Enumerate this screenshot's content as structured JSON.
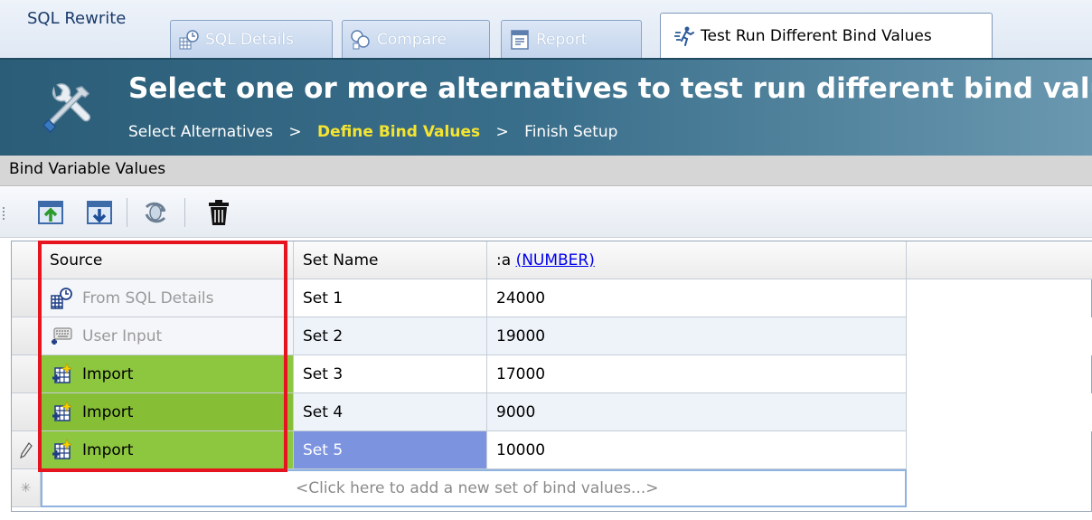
{
  "app": {
    "title": "SQL Rewrite"
  },
  "tabs": [
    {
      "label": "SQL Details",
      "icon": "sql-details-icon"
    },
    {
      "label": "Compare",
      "icon": "compare-icon"
    },
    {
      "label": "Report",
      "icon": "report-icon"
    },
    {
      "label": "Test Run Different Bind Values",
      "icon": "test-run-icon"
    }
  ],
  "banner": {
    "title": "Select one or more alternatives to test run different bind values",
    "breadcrumb": {
      "step1": "Select Alternatives",
      "separator": ">",
      "step2": "Define Bind Values",
      "step3": "Finish Setup"
    }
  },
  "section": {
    "title": "Bind Variable Values"
  },
  "toolbar": {
    "buttons": [
      "import-icon",
      "export-icon",
      "refresh-icon",
      "trash-icon"
    ]
  },
  "grid": {
    "columns": {
      "source": "Source",
      "set_name": "Set Name",
      "var_name": ":a",
      "var_type": "(NUMBER)"
    },
    "rows": [
      {
        "source": "From SQL Details",
        "set_name": "Set 1",
        "value": "24000"
      },
      {
        "source": "User Input",
        "set_name": "Set 2",
        "value": "19000"
      },
      {
        "source": "Import",
        "set_name": "Set 3",
        "value": "17000"
      },
      {
        "source": "Import",
        "set_name": "Set 4",
        "value": "9000"
      },
      {
        "source": "Import",
        "set_name": "Set 5",
        "value": "10000"
      }
    ],
    "new_row_placeholder": "<Click here to add a new set of bind values...>"
  },
  "colors": {
    "banner": "#3a6f8b",
    "breadcrumb_current": "#f5e431",
    "import_highlight": "#8dc63f",
    "selection": "#7c93e0",
    "annotation_box": "#e6141e"
  }
}
